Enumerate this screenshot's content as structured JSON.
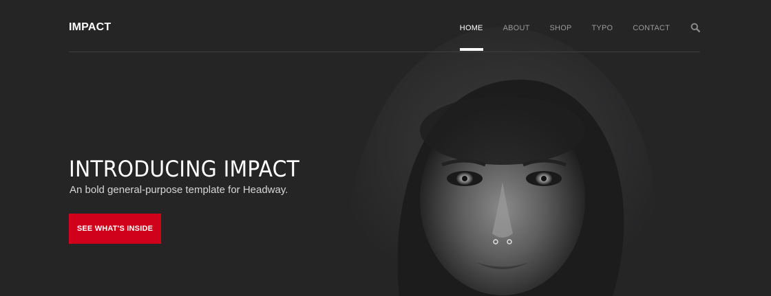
{
  "header": {
    "logo": "IMPACT",
    "nav": [
      {
        "label": "HOME",
        "active": true
      },
      {
        "label": "ABOUT",
        "active": false
      },
      {
        "label": "SHOP",
        "active": false
      },
      {
        "label": "TYPO",
        "active": false
      },
      {
        "label": "CONTACT",
        "active": false
      }
    ],
    "search_icon": "search-icon"
  },
  "hero": {
    "title": "INTRODUCING IMPACT",
    "subtitle": "An bold general-purpose template for Headway.",
    "cta_label": "SEE WHAT'S INSIDE"
  },
  "colors": {
    "background": "#252526",
    "accent": "#d0021b",
    "nav_inactive": "#9a9a9a",
    "nav_active": "#ffffff"
  }
}
